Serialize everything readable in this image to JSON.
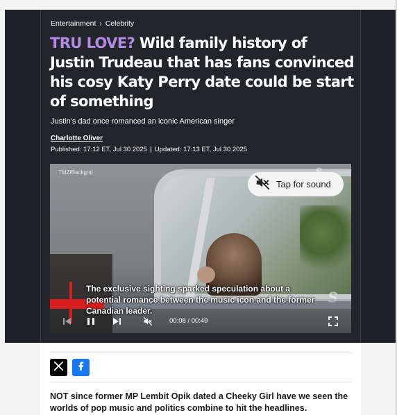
{
  "breadcrumb": {
    "section": "Entertainment",
    "subsection": "Celebrity"
  },
  "article": {
    "kicker": "TRU LOVE?",
    "headline": "Wild family history of Justin Trudeau that has fans convinced his cosy Katy Perry date could be start of something",
    "standfirst": "Justin's dad once romanced an iconic American singer",
    "author": "Charlotte Oliver",
    "published": "Published: 17:12 ET, Jul 30 2025",
    "updated": "Updated: 17:13 ET, Jul 30 2025",
    "body_first_line": "NOT since former MP Lembit Opik dated a Cheeky Girl have we seen the worlds of pop music and politics combine to hit the headlines."
  },
  "video": {
    "credit": "TMZ/Backgrid",
    "sound_button_label": "Tap for sound",
    "caption": "The exclusive sighting sparked speculation about a potential romance between the music icon and the former Canadian leader.",
    "current_time": "00:08",
    "duration": "00:49",
    "time_display": "00:08 / 00:49",
    "progress_fraction": 0.18,
    "watermark": "S"
  },
  "social": {
    "x_icon": "x-logo-icon",
    "facebook_icon": "facebook-icon"
  },
  "colors": {
    "kicker": "#b48ae6",
    "header_bg": "#22262a",
    "progress": "#d81f1f",
    "facebook": "#1877f2"
  }
}
